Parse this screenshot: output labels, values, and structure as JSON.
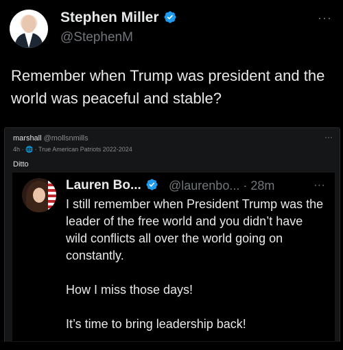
{
  "outer_tweet": {
    "name": "Stephen Miller",
    "handle": "@StephenM",
    "more": "···",
    "text": "Remember when Trump was president and the world was peaceful and stable?"
  },
  "reshare": {
    "name": "marshall",
    "handle": "@mollsnmills",
    "meta": "4h · 🌐 · True American Patriots 2022-2024",
    "more": "···",
    "body": "Ditto"
  },
  "inner_tweet": {
    "name": "Lauren Bo...",
    "handle": "@laurenbo... · 28m",
    "more": "···",
    "paragraphs": [
      "I still remember when President Trump was the leader of the free world and you didn’t have wild conflicts all over the world going on constantly.",
      "How I miss those days!",
      "It’s time to bring leadership back!"
    ]
  },
  "colors": {
    "background": "#000000",
    "text": "#e7e9ea",
    "muted": "#71767b",
    "verified_blue": "#1d9bf0",
    "reshare_bg": "#151617"
  },
  "icons": [
    "verified-badge-icon",
    "more-options-icon",
    "globe-icon"
  ]
}
